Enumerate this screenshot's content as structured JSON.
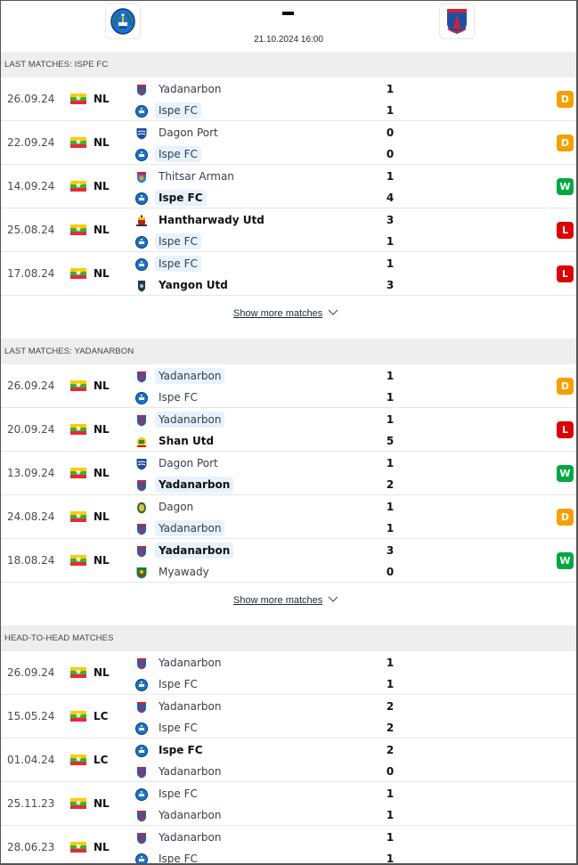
{
  "header": {
    "home_team": "Ispe FC",
    "away_team": "Yadanarbon",
    "score": "-",
    "datetime": "21.10.2024 16:00"
  },
  "colors": {
    "draw": "#f5a000",
    "win": "#00a83f",
    "loss": "#dc0000",
    "highlight": "#e6f2fd"
  },
  "sections": [
    {
      "title": "LAST MATCHES: ISPE FC",
      "show_more": "Show more matches",
      "matches": [
        {
          "date": "26.09.24",
          "country": "Myanmar",
          "comp": "NL",
          "team1": "Yadanarbon",
          "logo1": "yadanarbon",
          "team2": "Ispe FC",
          "logo2": "ispe",
          "score1": "1",
          "score2": "1",
          "hl": 2,
          "winner": 0,
          "result": "D"
        },
        {
          "date": "22.09.24",
          "country": "Myanmar",
          "comp": "NL",
          "team1": "Dagon Port",
          "logo1": "dagonport",
          "team2": "Ispe FC",
          "logo2": "ispe",
          "score1": "0",
          "score2": "0",
          "hl": 2,
          "winner": 0,
          "result": "D"
        },
        {
          "date": "14.09.24",
          "country": "Myanmar",
          "comp": "NL",
          "team1": "Thitsar Arman",
          "logo1": "thitsar",
          "team2": "Ispe FC",
          "logo2": "ispe",
          "score1": "1",
          "score2": "4",
          "hl": 2,
          "winner": 2,
          "result": "W"
        },
        {
          "date": "25.08.24",
          "country": "Myanmar",
          "comp": "NL",
          "team1": "Hantharwady Utd",
          "logo1": "hantharwady",
          "team2": "Ispe FC",
          "logo2": "ispe",
          "score1": "3",
          "score2": "1",
          "hl": 2,
          "winner": 1,
          "result": "L"
        },
        {
          "date": "17.08.24",
          "country": "Myanmar",
          "comp": "NL",
          "team1": "Ispe FC",
          "logo1": "ispe",
          "team2": "Yangon Utd",
          "logo2": "yangon",
          "score1": "1",
          "score2": "3",
          "hl": 1,
          "winner": 2,
          "result": "L"
        }
      ]
    },
    {
      "title": "LAST MATCHES: YADANARBON",
      "show_more": "Show more matches",
      "matches": [
        {
          "date": "26.09.24",
          "country": "Myanmar",
          "comp": "NL",
          "team1": "Yadanarbon",
          "logo1": "yadanarbon",
          "team2": "Ispe FC",
          "logo2": "ispe",
          "score1": "1",
          "score2": "1",
          "hl": 1,
          "winner": 0,
          "result": "D"
        },
        {
          "date": "20.09.24",
          "country": "Myanmar",
          "comp": "NL",
          "team1": "Yadanarbon",
          "logo1": "yadanarbon",
          "team2": "Shan Utd",
          "logo2": "shan",
          "score1": "1",
          "score2": "5",
          "hl": 1,
          "winner": 2,
          "result": "L"
        },
        {
          "date": "13.09.24",
          "country": "Myanmar",
          "comp": "NL",
          "team1": "Dagon Port",
          "logo1": "dagonport",
          "team2": "Yadanarbon",
          "logo2": "yadanarbon",
          "score1": "1",
          "score2": "2",
          "hl": 2,
          "winner": 2,
          "result": "W"
        },
        {
          "date": "24.08.24",
          "country": "Myanmar",
          "comp": "NL",
          "team1": "Dagon",
          "logo1": "dagon",
          "team2": "Yadanarbon",
          "logo2": "yadanarbon",
          "score1": "1",
          "score2": "1",
          "hl": 2,
          "winner": 0,
          "result": "D"
        },
        {
          "date": "18.08.24",
          "country": "Myanmar",
          "comp": "NL",
          "team1": "Yadanarbon",
          "logo1": "yadanarbon",
          "team2": "Myawady",
          "logo2": "myawady",
          "score1": "3",
          "score2": "0",
          "hl": 1,
          "winner": 1,
          "result": "W"
        }
      ]
    },
    {
      "title": "HEAD-TO-HEAD MATCHES",
      "matches": [
        {
          "date": "26.09.24",
          "country": "Myanmar",
          "comp": "NL",
          "team1": "Yadanarbon",
          "logo1": "yadanarbon",
          "team2": "Ispe FC",
          "logo2": "ispe",
          "score1": "1",
          "score2": "1",
          "hl": 0,
          "winner": 0,
          "result": ""
        },
        {
          "date": "15.05.24",
          "country": "Myanmar",
          "comp": "LC",
          "team1": "Yadanarbon",
          "logo1": "yadanarbon",
          "team2": "Ispe FC",
          "logo2": "ispe",
          "score1": "2",
          "score2": "2",
          "hl": 0,
          "winner": 0,
          "result": ""
        },
        {
          "date": "01.04.24",
          "country": "Myanmar",
          "comp": "LC",
          "team1": "Ispe FC",
          "logo1": "ispe",
          "team2": "Yadanarbon",
          "logo2": "yadanarbon",
          "score1": "2",
          "score2": "0",
          "hl": 0,
          "winner": 1,
          "result": ""
        },
        {
          "date": "25.11.23",
          "country": "Myanmar",
          "comp": "NL",
          "team1": "Ispe FC",
          "logo1": "ispe",
          "team2": "Yadanarbon",
          "logo2": "yadanarbon",
          "score1": "1",
          "score2": "1",
          "hl": 0,
          "winner": 0,
          "result": ""
        },
        {
          "date": "28.06.23",
          "country": "Myanmar",
          "comp": "NL",
          "team1": "Yadanarbon",
          "logo1": "yadanarbon",
          "team2": "Ispe FC",
          "logo2": "ispe",
          "score1": "1",
          "score2": "1",
          "hl": 0,
          "winner": 0,
          "result": ""
        }
      ]
    }
  ]
}
